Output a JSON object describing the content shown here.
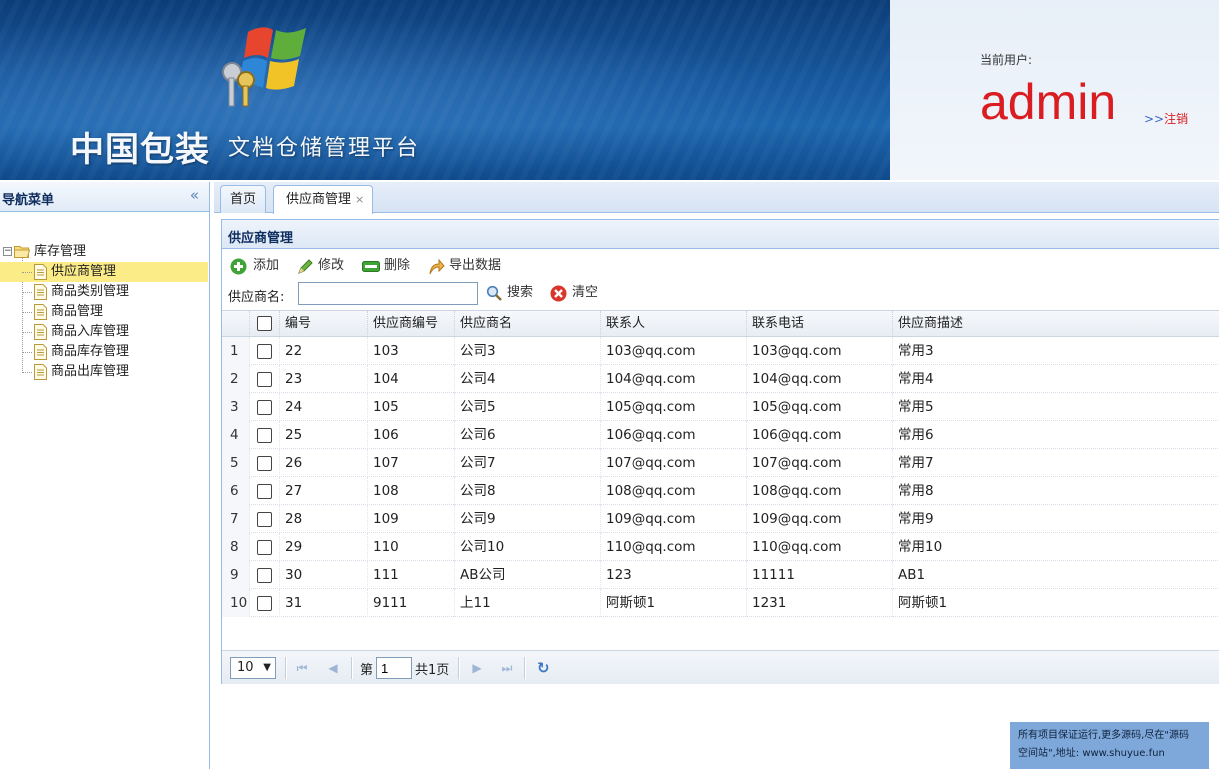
{
  "header": {
    "brand_main": "中国包装",
    "brand_sub": "文档仓储管理平台",
    "user_label": "当前用户:",
    "user_name": "admin",
    "logout_arrows": ">>",
    "logout_label": "注销"
  },
  "nav": {
    "title": "导航菜单",
    "collapse_icon": "«",
    "root": {
      "label": "库存管理",
      "expander": "−"
    },
    "items": [
      {
        "label": "供应商管理",
        "selected": true
      },
      {
        "label": "商品类别管理",
        "selected": false
      },
      {
        "label": "商品管理",
        "selected": false
      },
      {
        "label": "商品入库管理",
        "selected": false
      },
      {
        "label": "商品库存管理",
        "selected": false
      },
      {
        "label": "商品出库管理",
        "selected": false
      }
    ]
  },
  "tabs": [
    {
      "label": "首页",
      "closable": false,
      "active": false
    },
    {
      "label": "供应商管理",
      "closable": true,
      "active": true,
      "close_icon": "×"
    }
  ],
  "panel": {
    "title": "供应商管理",
    "toolbar": {
      "add": "添加",
      "edit": "修改",
      "delete": "删除",
      "export": "导出数据"
    },
    "search": {
      "label": "供应商名:",
      "value": "",
      "search_button": "搜索",
      "clear_button": "清空"
    },
    "grid": {
      "columns": [
        "编号",
        "供应商编号",
        "供应商名",
        "联系人",
        "联系电话",
        "供应商描述"
      ],
      "rows": [
        {
          "num": "1",
          "id": "22",
          "code": "103",
          "name": "公司3",
          "contact": "103@qq.com",
          "phone": "103@qq.com",
          "desc": "常用3"
        },
        {
          "num": "2",
          "id": "23",
          "code": "104",
          "name": "公司4",
          "contact": "104@qq.com",
          "phone": "104@qq.com",
          "desc": "常用4"
        },
        {
          "num": "3",
          "id": "24",
          "code": "105",
          "name": "公司5",
          "contact": "105@qq.com",
          "phone": "105@qq.com",
          "desc": "常用5"
        },
        {
          "num": "4",
          "id": "25",
          "code": "106",
          "name": "公司6",
          "contact": "106@qq.com",
          "phone": "106@qq.com",
          "desc": "常用6"
        },
        {
          "num": "5",
          "id": "26",
          "code": "107",
          "name": "公司7",
          "contact": "107@qq.com",
          "phone": "107@qq.com",
          "desc": "常用7"
        },
        {
          "num": "6",
          "id": "27",
          "code": "108",
          "name": "公司8",
          "contact": "108@qq.com",
          "phone": "108@qq.com",
          "desc": "常用8"
        },
        {
          "num": "7",
          "id": "28",
          "code": "109",
          "name": "公司9",
          "contact": "109@qq.com",
          "phone": "109@qq.com",
          "desc": "常用9"
        },
        {
          "num": "8",
          "id": "29",
          "code": "110",
          "name": "公司10",
          "contact": "110@qq.com",
          "phone": "110@qq.com",
          "desc": "常用10"
        },
        {
          "num": "9",
          "id": "30",
          "code": "111",
          "name": "AB公司",
          "contact": "123",
          "phone": "11111",
          "desc": "AB1"
        },
        {
          "num": "10",
          "id": "31",
          "code": "9111",
          "name": "上11",
          "contact": "阿斯顿1",
          "phone": "1231",
          "desc": "阿斯顿1"
        }
      ]
    },
    "pager": {
      "page_size": "10",
      "page_prefix": "第",
      "page_number": "1",
      "page_total": "共1页"
    }
  },
  "watermark": {
    "line1": "所有项目保证运行,更多源码,尽在\"源码",
    "line2": "空间站\",地址: www.shuyue.fun"
  },
  "colors": {
    "header_blue": "#17589e",
    "user_red": "#d91d20",
    "selected_row": "#fbec88",
    "border_blue": "#99bbe8"
  }
}
